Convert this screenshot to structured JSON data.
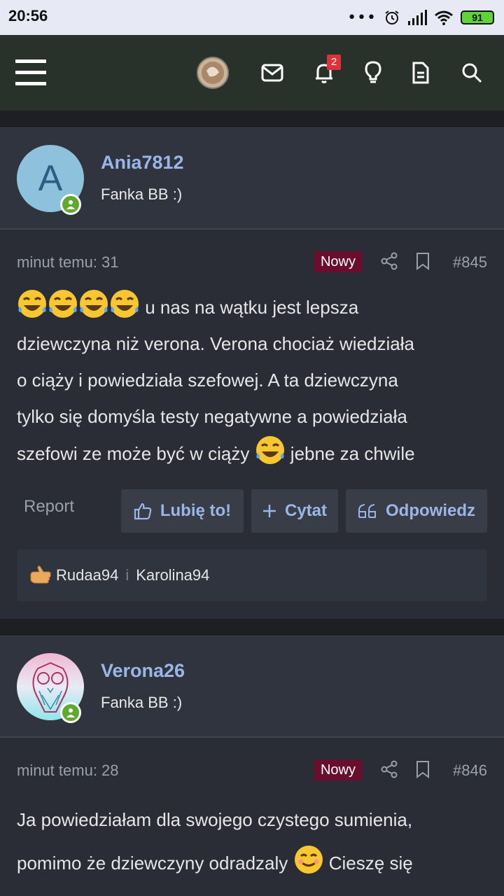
{
  "status_bar": {
    "time": "20:56",
    "battery": "91"
  },
  "navbar": {
    "notification_count": "2"
  },
  "posts": [
    {
      "username": "Ania7812",
      "avatar_letter": "A",
      "user_title": "Fanka BB :)",
      "time": "minut temu: 31",
      "badge": "Nowy",
      "number": "#845",
      "body_line1": "u nas na wątku jest lepsza",
      "body_line2": "dziewczyna niż verona. Verona chociaż wiedziała",
      "body_line3": "o ciąży i powiedziała szefowej. A ta dziewczyna",
      "body_line4": "tylko się domyśla testy negatywne a powiedziała",
      "body_line5a": "szefowi ze może być w ciąży",
      "body_line5b": "jebne za chwile",
      "report": "Report",
      "like_label": "Lubię to!",
      "quote_label": "Cytat",
      "reply_label": "Odpowiedz",
      "liked_by": [
        "Rudaa94",
        "Karolina94"
      ],
      "liked_sep": "i"
    },
    {
      "username": "Verona26",
      "user_title": "Fanka BB :)",
      "time": "minut temu: 28",
      "badge": "Nowy",
      "number": "#846",
      "body_line1": "Ja powiedziałam dla swojego czystego sumienia,",
      "body_line2a": "pomimo że dziewczyny odradzaly",
      "body_line2b": "Cieszę się"
    }
  ],
  "colors": {
    "navbar": "#29322a",
    "post_bg": "#2a2d35",
    "link": "#9ab6e6",
    "new_badge": "#6b0e2e"
  }
}
